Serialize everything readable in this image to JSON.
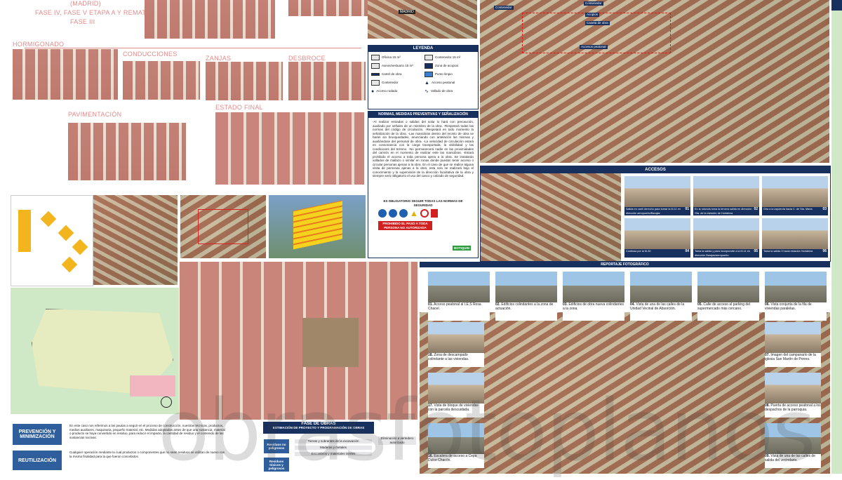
{
  "phases": {
    "madrid": "(MADRID)",
    "fase_iv": "FASE IV, FASE V ETAPA A Y REMATES",
    "fase_iii": "FASE III",
    "hormigonado": "HORMIGONADO",
    "conducciones": "CONDUCCIONES",
    "zanjas": "ZANJAS",
    "desbroce": "DESBROCE",
    "pavimentacion": "PAVIMENTACIÓN",
    "estado_final": "ESTADO FINAL"
  },
  "location_map": {
    "label": "MADRID"
  },
  "site_plan": {
    "labels": [
      "Contenedor",
      "Acopios",
      "Caseta de obra",
      "Accesos peatonal",
      "Contenedor"
    ]
  },
  "leyenda": {
    "title": "LEYENDA",
    "items": [
      "Oficina 15 m²",
      "Contenedor 15 m²",
      "Aseos/vestuario 15 m²",
      "Zona de acopios",
      "Cartel de obra",
      "Punto limpio",
      "Contenedor",
      "Acceso peatonal",
      "Acceso rodado",
      "Vallado de obra"
    ]
  },
  "normas": {
    "title": "NORMAS, MEDIDAS PREVENTIVAS Y SEÑALIZACIÓN",
    "text": "-Al realizar entradas o salidas del solar lo hará con precaución, auxiliado por señales de un miembro de la obra. -Respetará todas las normas del código de circulación. -Respetará en todo momento la señalización de la obra. -Las maniobras dentro del recinto de obra se harán sin brusquedades, anunciando con antelación las mismas y auxiliándose del personal de obra. -La velocidad de circulación estará en consonancia con la carga transportada, la visibilidad y las condiciones del terreno. -No permanecerá nadie en las proximidades del camión en el momento de realizar este las maniobras. -Estará prohibido el acceso a toda persona ajena a la obra. Se instalarán vallados de mallazo o similar en zonas donde puedan tener acceso o circular personas ajenas a la obra. En el caso de que se realice alguna visita de personas ajenas a la obra, esta solo se realizará bajo el conocimiento y la supervisión de la dirección facultativa de la obra y siempre será obligatorio el uso del casco y calzado de seguridad.",
    "sign_title": "ES OBLIGATORIO SEGUIR TODAS LAS NORMAS DE SEGURIDAD",
    "prohibido": "PROHIBIDO EL PASO A TODA PERSONA NO AUTORIZADA",
    "botiquin": "BOTIQUIN"
  },
  "accesos": {
    "title": "ACCESOS",
    "photos": [
      {
        "num": "01",
        "text": "Salida en carril derecho para tomar la M-11 en dirección aeropuerto/Barajas"
      },
      {
        "num": "02",
        "text": "En la rotonda toma la tercera salida en dirección Gta. de la estación de Hortaleza"
      },
      {
        "num": "03",
        "text": "Gira a la izquierda hacia C. de Sta. María"
      },
      {
        "num": "04",
        "text": "Continúa por la M-30"
      },
      {
        "num": "05",
        "text": "Toma la salida y para incorporarte a la M-11 en dirección Barajas/aeropuerto"
      },
      {
        "num": "06",
        "text": "Toma la salida 3 hacia estación Hortaleza"
      }
    ]
  },
  "reportaje": {
    "title": "REPORTAJE FOTOGRÁFICO",
    "items": [
      {
        "num": "01.",
        "text": "Acceso peatonal al I.E.S Rosa Chacel."
      },
      {
        "num": "02.",
        "text": "Edificios colindantes a la zona de actuación."
      },
      {
        "num": "03.",
        "text": "Edificios de obra nueva colindantes a la zona."
      },
      {
        "num": "04.",
        "text": "Vista de una de las calles de la Unidad Vecinal de Absorción."
      },
      {
        "num": "05.",
        "text": "Calle de acceso al parking del supermercado más cercano."
      },
      {
        "num": "06.",
        "text": "Vista conjunta de la fila de viviendas paralelas."
      },
      {
        "num": "07.",
        "text": "Imagen del campanario de la iglesia San Martín de Porres."
      },
      {
        "num": "08.",
        "text": "Puerta de acceso peatonal a los despachos de la parroquia."
      },
      {
        "num": "09.",
        "text": "Vista de una de las calles de salida del vecindario."
      },
      {
        "num": "16.",
        "text": "Escalera de acceso a Cepa Dulce Chacón."
      },
      {
        "num": "17.",
        "text": "Vista de bloque de viviendas con la parcela descuidada."
      },
      {
        "num": "18.",
        "text": "Zona de descampado colindante a las viviendas."
      }
    ]
  },
  "residuos": {
    "prevencion": "PREVENCIÓN Y MINIMIZACIÓN",
    "reutilizacion": "REUTILIZACIÓN",
    "prevencion_text": "En este caso nos referimos a las pautas a seguir en el proceso de construcción, nuestras técnicas, productos, medios auxiliares, maquinaria, pequeño material, etc. Medidas adoptadas antes de que una sustancia, material o producto se haya convertido en residuo, para reducir el impacto, la cantidad de residuo y el contenido de las sustancias nocivas.",
    "reutilizacion_text": "Cualquier operación mediante la cual productos o componentes que no sean residuos se utilizan de nuevo con la misma finalidad para la que fueron concebidos.",
    "fase_title": "FASE DE OBRAS",
    "fase_sub": "ESTIMACIÓN DE PROYECTO Y PROGRAMACIÓN DE OBRAS",
    "residuos_no": "Residuos no peligrosos",
    "residuos_toxicos": "Residuos tóxicos y peligrosos",
    "rows": [
      "Tierras y sobrantes de la excavación",
      "Maderas y metales",
      "Escombros y materiales inertes"
    ],
    "eliminacion": "Eliminación a vertedero autorizado"
  },
  "watermark": "obrasfotoplanos"
}
